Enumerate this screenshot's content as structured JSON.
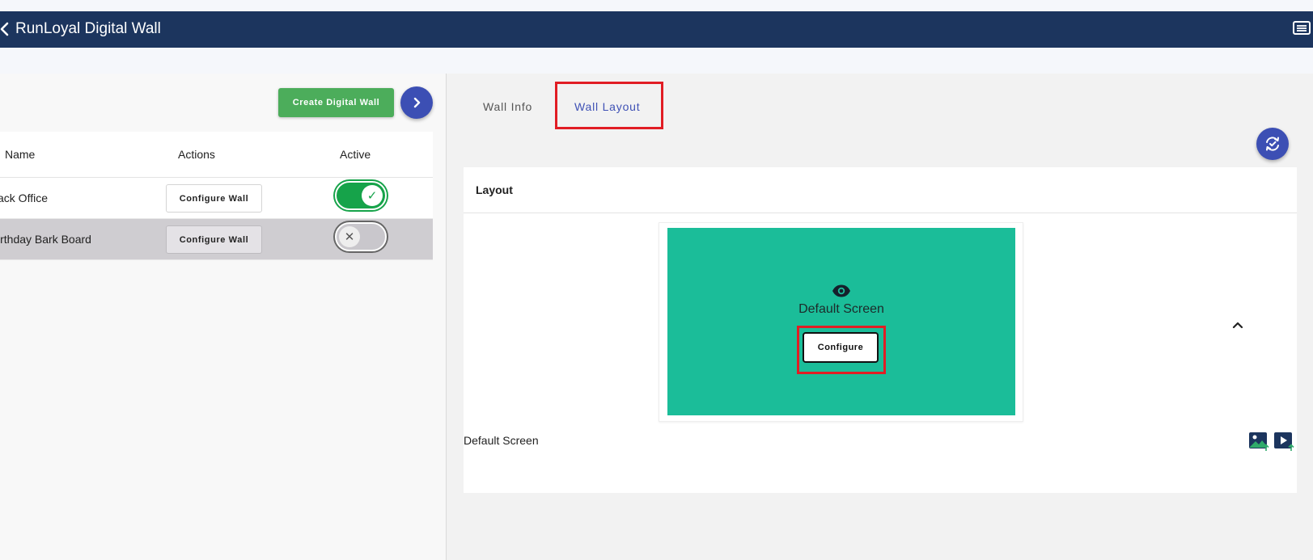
{
  "header": {
    "title": "RunLoyal Digital Wall"
  },
  "left": {
    "create_label": "Create Digital Wall",
    "columns": [
      "Name",
      "Actions",
      "Active"
    ],
    "rows": [
      {
        "name": "ack Office",
        "action": "Configure Wall",
        "active": true
      },
      {
        "name": "irthday Bark Board",
        "action": "Configure Wall",
        "active": false
      }
    ]
  },
  "tabs": [
    {
      "label": "Wall Info",
      "selected": false
    },
    {
      "label": "Wall Layout",
      "selected": true
    }
  ],
  "layout": {
    "section_title": "Layout",
    "screen_label": "Default Screen",
    "configure_label": "Configure",
    "caption": "Default Screen"
  },
  "icons": {
    "back": "chevron-left-icon",
    "menu": "list-menu-icon",
    "next": "chevron-right-icon",
    "refresh": "refresh-check-icon",
    "eye": "eye-icon",
    "collapse": "chevron-up-icon",
    "image_upload": "image-upload-icon",
    "video_upload": "video-upload-icon"
  },
  "colors": {
    "header_bg": "#1c355e",
    "accent": "#3c4fb4",
    "create_btn": "#4cad5b",
    "screen_bg": "#1bbd99",
    "toggle_on": "#16a34a",
    "highlight": "#e11d24"
  }
}
